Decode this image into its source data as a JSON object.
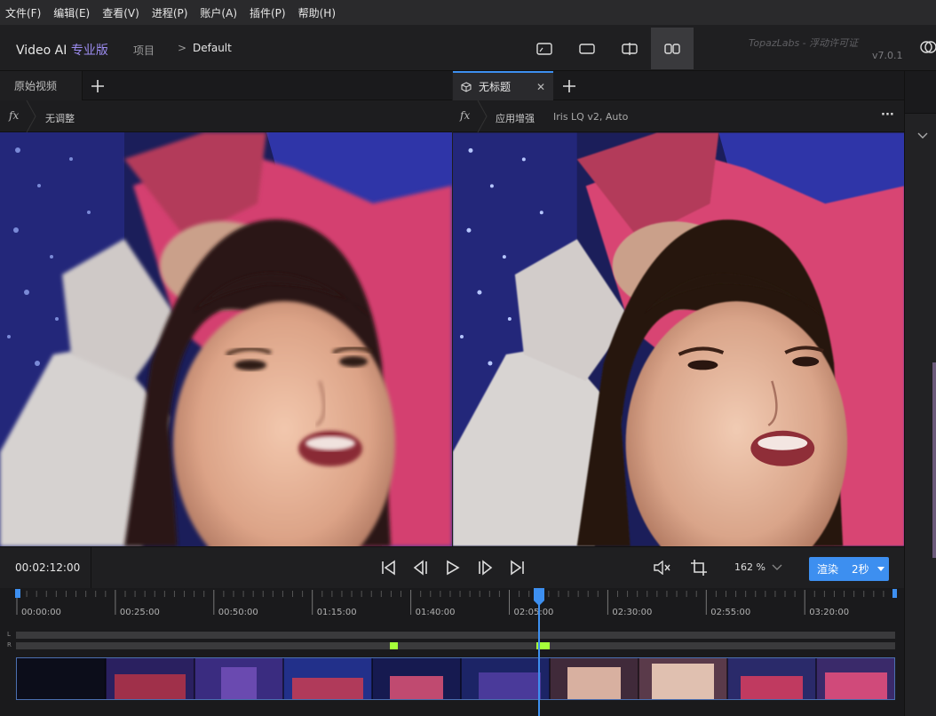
{
  "menu": [
    "文件(F)",
    "编辑(E)",
    "查看(V)",
    "进程(P)",
    "账户(A)",
    "插件(P)",
    "帮助(H)"
  ],
  "app": {
    "name": "Video AI",
    "edition": "专业版",
    "project_label": "项目",
    "project_name": "Default",
    "license": "TopazLabs - 浮动许可证",
    "version": "v7.0.1"
  },
  "view_modes": [
    "single-view-icon",
    "full-view-icon",
    "split-view-icon",
    "side-by-side-icon"
  ],
  "left_pane": {
    "tab_label": "原始视频",
    "fx_label": "无调整"
  },
  "right_pane": {
    "tab_label": "无标题",
    "fx_label": "应用增强",
    "model": "Iris LQ v2, Auto",
    "more": "···"
  },
  "transport": {
    "timecode": "00:02:12:00",
    "zoom": "162 %",
    "render_label": "渲染",
    "render_duration": "2秒"
  },
  "timeline": {
    "ticks": [
      "00:00:00",
      "00:25:00",
      "00:50:00",
      "01:15:00",
      "01:40:00",
      "02:05:00",
      "02:30:00",
      "02:55:00",
      "03:20:00"
    ],
    "playhead_position": 0.5943,
    "track_labels": [
      "L",
      "R"
    ]
  },
  "colors": {
    "accent": "#3d8ff0",
    "pro": "#9c8cf0",
    "audio_marker": "#a6ff3a"
  }
}
